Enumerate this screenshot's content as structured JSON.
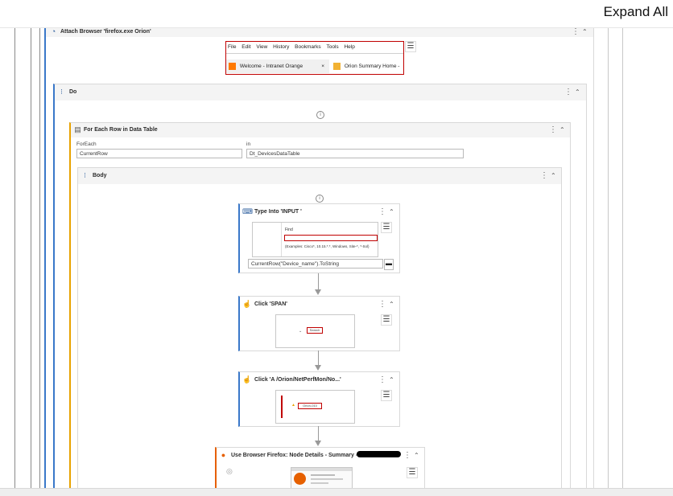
{
  "toolbar": {
    "expand_all": "Expand All"
  },
  "attach": {
    "title": "Attach Browser 'firefox.exe Orion'",
    "menu": [
      "File",
      "Edit",
      "View",
      "History",
      "Bookmarks",
      "Tools",
      "Help"
    ],
    "tab1": "Welcome - Intranet Orange",
    "tab2": "Orion Summary Home -"
  },
  "do": {
    "title": "Do"
  },
  "foreach": {
    "title": "For Each Row in Data Table",
    "foreach_label": "ForEach",
    "foreach_value": "CurrentRow",
    "in_label": "in",
    "in_value": "Dt_DevicesDataTable"
  },
  "body": {
    "title": "Body"
  },
  "type_into": {
    "title": "Type Into 'INPUT '",
    "thumb_label": "Find",
    "thumb_example": "(Examples: Cisco*, 10.15.*.*, Windows, Site-*, *-Sol)",
    "value": "CurrentRow(\"Device_name\").ToString"
  },
  "click_span": {
    "title": "Click 'SPAN'",
    "thumb_button": "Search"
  },
  "click_a": {
    "title": "Click 'A  /Orion/NetPerfMon/No...'",
    "thumb_link": "Orion-010"
  },
  "use_browser": {
    "title": "Use Browser Firefox: Node Details - Summary - "
  },
  "colors": {
    "accent_blue": "#3a78c9",
    "accent_orange": "#e8a200",
    "firefox_orange": "#e66000",
    "selection_red": "#c00000"
  }
}
